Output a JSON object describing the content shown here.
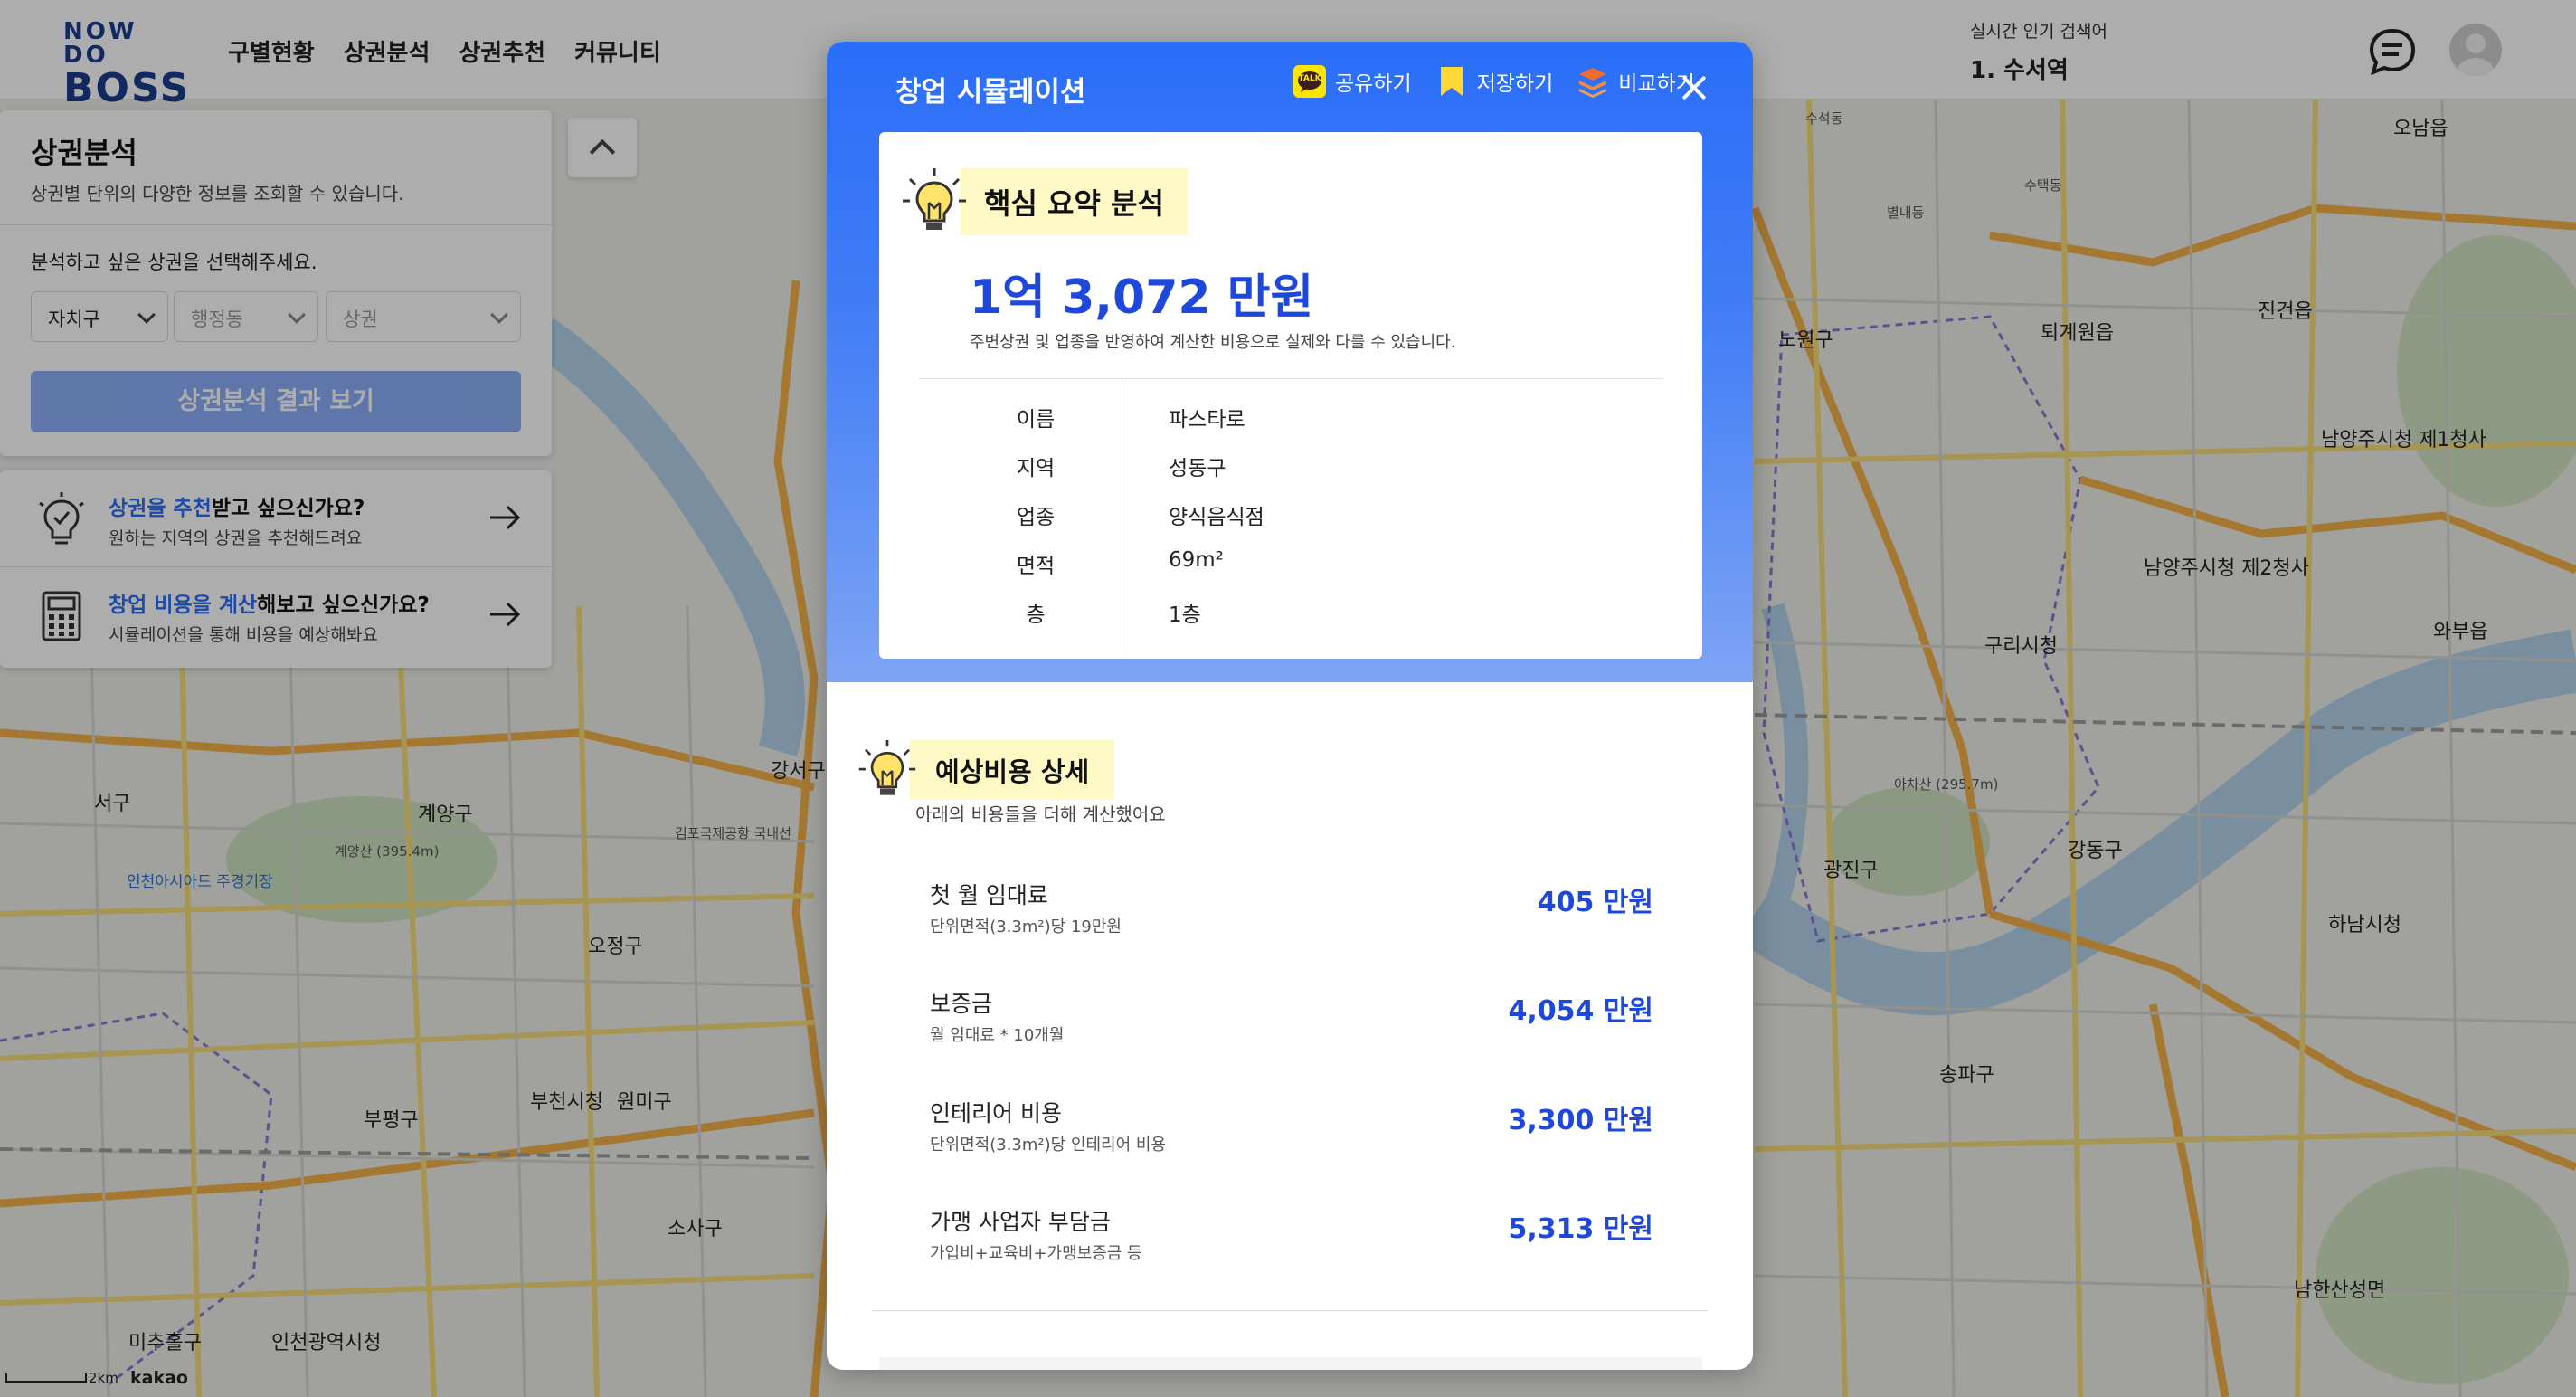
{
  "header": {
    "logo_top": "NOW DO",
    "logo_bottom": "BOSS",
    "nav": [
      "구별현황",
      "상권분석",
      "상권추천",
      "커뮤니티"
    ],
    "trend_title": "실시간 인기 검색어",
    "trend_item": "1. 수서역"
  },
  "panel": {
    "title": "상권분석",
    "subtitle": "상권별 단위의 다양한 정보를 조회할 수 있습니다.",
    "prompt": "분석하고 싶은 상권을 선택해주세요.",
    "select_district": "자치구",
    "select_dong": "행정동",
    "select_area": "상권",
    "result_button": "상권분석 결과 보기"
  },
  "cards": [
    {
      "highlight": "상권을 추천",
      "rest": "받고 싶으신가요?",
      "desc": "원하는 지역의 상권을 추천해드려요"
    },
    {
      "highlight": "창업 비용을 계산",
      "rest": "해보고 싶으신가요?",
      "desc": "시뮬레이션을 통해 비용을 예상해봐요"
    }
  ],
  "modal": {
    "title": "창업 시뮬레이션",
    "share": "공유하기",
    "save": "저장하기",
    "compare": "비교하기",
    "kakao_badge": "TALK",
    "summary": {
      "heading": "핵심 요약 분석",
      "amount": "1억 3,072 만원",
      "note": "주변상권 및 업종을 반영하여 계산한 비용으로 실제와 다를 수 있습니다.",
      "rows": [
        {
          "key": "이름",
          "value": "파스타로"
        },
        {
          "key": "지역",
          "value": "성동구"
        },
        {
          "key": "업종",
          "value": "양식음식점"
        },
        {
          "key": "면적",
          "value": "69m²"
        },
        {
          "key": "층",
          "value": "1층"
        }
      ]
    },
    "cost": {
      "heading": "예상비용 상세",
      "subtitle": "아래의 비용들을 더해 계산했어요",
      "items": [
        {
          "label": "첫 월 임대료",
          "desc": "단위면적(3.3m²)당 19만원",
          "value": "405 만원"
        },
        {
          "label": "보증금",
          "desc": "월 임대료 * 10개월",
          "value": "4,054 만원"
        },
        {
          "label": "인테리어 비용",
          "desc": "단위면적(3.3m²)당 인테리어 비용",
          "value": "3,300 만원"
        },
        {
          "label": "가맹 사업자 부담금",
          "desc": "가입비+교육비+가맹보증금 등",
          "value": "5,313 만원"
        }
      ]
    }
  },
  "map": {
    "labels": [
      "서구",
      "계양구",
      "계양산 (395.4m)",
      "인천아시아드 주경기장",
      "오정구",
      "부평구",
      "부천시청",
      "원미구",
      "소사구",
      "미추홀구",
      "인천광역시청",
      "강서구",
      "김포국제공항 국내선",
      "노원구",
      "진건읍",
      "남양주시청 제1청사",
      "남양주시청 제2청사",
      "구리시청",
      "와부읍",
      "아차산 (295.7m)",
      "광진구",
      "강동구",
      "하남시청",
      "송파구",
      "남한산성면",
      "오남읍",
      "퇴계원읍",
      "수석동",
      "별내동",
      "수택동"
    ],
    "scale": "2km",
    "attribution": "kakao"
  },
  "colors": {
    "accent": "#2d6ef6",
    "amount": "#1e47db",
    "highlight_bg": "#fff9c6",
    "logo": "#1b3b8f"
  },
  "icons": [
    "chat-icon",
    "user-avatar-icon",
    "chevron-down-icon",
    "chevron-up-icon",
    "lightbulb-icon",
    "calculator-icon",
    "arrow-right-icon",
    "kakaotalk-icon",
    "bookmark-icon",
    "stack-icon",
    "close-icon"
  ]
}
